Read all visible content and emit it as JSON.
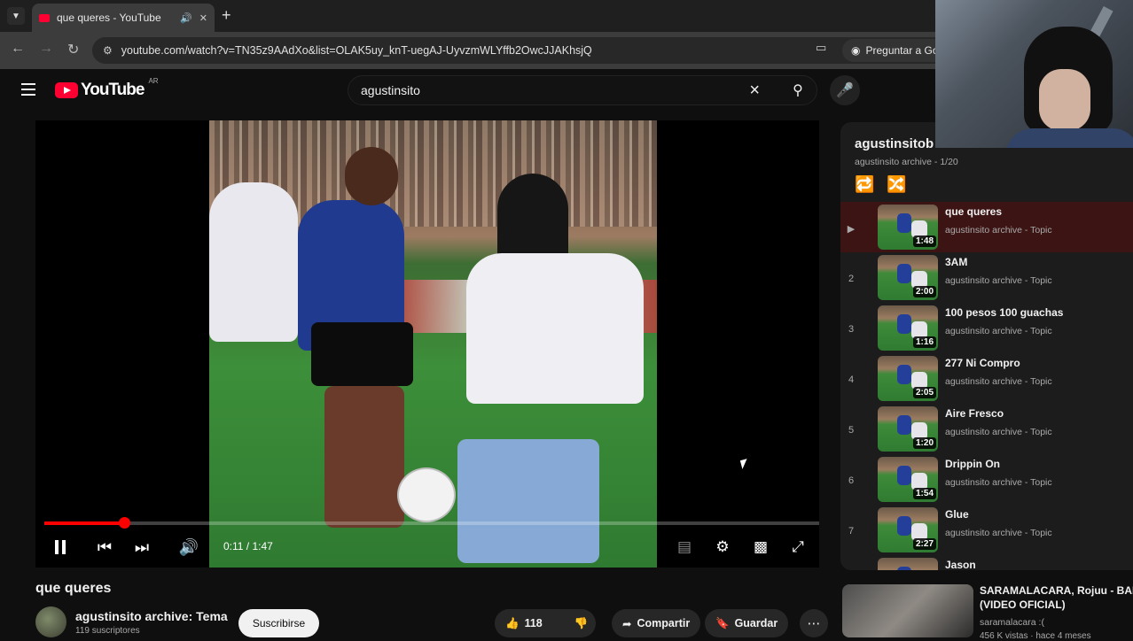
{
  "browser": {
    "tab_title": "que queres - YouTube",
    "url": "youtube.com/watch?v=TN35z9AAdXo&list=OLAK5uy_knT-uegAJ-UyvzmWLYffb2OwcJJAKhsjQ",
    "ask_label": "Preguntar a Go"
  },
  "header": {
    "logo_text": "YouTube",
    "country_code": "AR",
    "search_query": "agustinsito"
  },
  "player": {
    "current_time": "0:11",
    "duration": "1:47",
    "time_display": "0:11 / 1:47",
    "progress_fraction": 0.103
  },
  "video": {
    "title": "que queres",
    "channel_name": "agustinsito archive: Tema",
    "subscribers": "119 suscriptores",
    "subscribe_label": "Suscribirse",
    "likes": "118",
    "share_label": "Compartir",
    "save_label": "Guardar"
  },
  "playlist": {
    "title": "agustinsitob",
    "owner": "agustinsito archive",
    "position": "1/20",
    "items": [
      {
        "index": "▶",
        "title": "que queres",
        "artist": "agustinsito archive - Topic",
        "duration": "1:48",
        "active": true
      },
      {
        "index": "2",
        "title": "3AM",
        "artist": "agustinsito archive - Topic",
        "duration": "2:00"
      },
      {
        "index": "3",
        "title": "100 pesos 100 guachas",
        "artist": "agustinsito archive - Topic",
        "duration": "1:16"
      },
      {
        "index": "4",
        "title": "277 Ni Compro",
        "artist": "agustinsito archive - Topic",
        "duration": "2:05"
      },
      {
        "index": "5",
        "title": "Aire Fresco",
        "artist": "agustinsito archive - Topic",
        "duration": "1:20"
      },
      {
        "index": "6",
        "title": "Drippin On",
        "artist": "agustinsito archive - Topic",
        "duration": "1:54"
      },
      {
        "index": "7",
        "title": "Glue",
        "artist": "agustinsito archive - Topic",
        "duration": "2:27"
      },
      {
        "index": "",
        "title": "Jason",
        "artist": "",
        "duration": ""
      }
    ]
  },
  "recommendation": {
    "title": "SARAMALACARA, Rojuu - BAP$",
    "title_line2": "(VIDEO OFICIAL)",
    "channel": "saramalacara :(",
    "meta": "456 K vistas · hace 4 meses"
  },
  "colors": {
    "accent": "#ff0000",
    "background": "#0f0f0f",
    "active_row": "#3c1414"
  },
  "icons": {
    "pause": "pause-icon",
    "prev": "skip-previous-icon",
    "next": "skip-next-icon",
    "volume": "volume-icon",
    "subtitles": "subtitles-icon",
    "settings": "gear-icon",
    "theater": "theater-mode-icon",
    "fullscreen": "fullscreen-icon"
  }
}
